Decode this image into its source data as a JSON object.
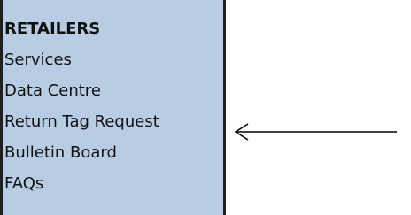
{
  "menu": {
    "heading": "RETAILERS",
    "items": [
      {
        "label": "Services"
      },
      {
        "label": "Data Centre"
      },
      {
        "label": "Return Tag Request"
      },
      {
        "label": "Bulletin Board"
      },
      {
        "label": "FAQs"
      }
    ]
  },
  "annotation": {
    "icon": "left-arrow-icon",
    "points_to": "Return Tag Request"
  },
  "colors": {
    "panel_background": "#b8cce4",
    "panel_border": "#1f1f1f",
    "text": "#111111",
    "arrow": "#000000"
  }
}
